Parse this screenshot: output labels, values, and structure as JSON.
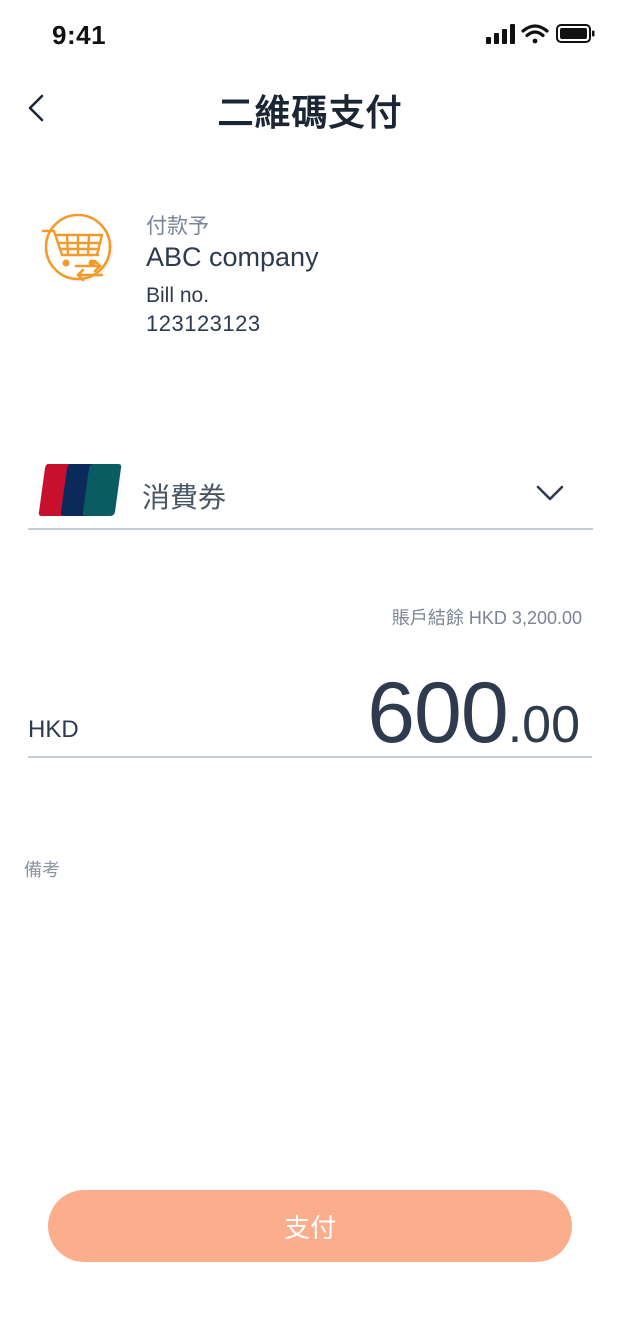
{
  "status_bar": {
    "time": "9:41",
    "icons": [
      "signal-icon",
      "wifi-icon",
      "battery-icon"
    ]
  },
  "header": {
    "title": "二維碼支付",
    "back_icon": "back-chevron-icon"
  },
  "payee": {
    "label": "付款予",
    "name": "ABC company",
    "bill_label": "Bill no.",
    "bill_number": "123123123",
    "logo_icon": "shopping-cart-icon"
  },
  "payment_method": {
    "selected": "消費券",
    "card_icon": "card-stack-icon",
    "dropdown_icon": "chevron-down-icon"
  },
  "balance": {
    "text": "賬戶結餘 HKD 3,200.00"
  },
  "amount": {
    "currency": "HKD",
    "integer": "600",
    "decimal": ".00"
  },
  "remarks": {
    "placeholder": "備考",
    "value": ""
  },
  "pay_button": {
    "label": "支付"
  },
  "colors": {
    "accent": "#fbad8c",
    "logo_orange": "#f39a2b",
    "text_dark": "#2e3a4d",
    "card_red": "#c8102e",
    "card_navy": "#0b2a5b",
    "card_teal": "#0a5c63"
  }
}
